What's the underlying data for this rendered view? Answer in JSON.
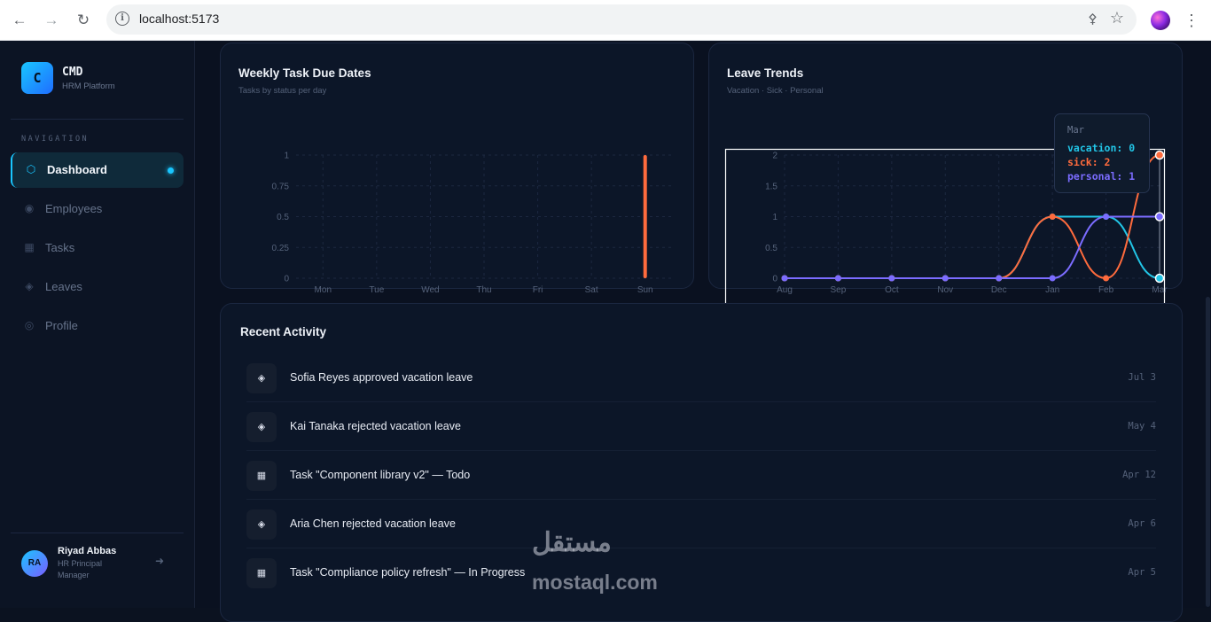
{
  "browser": {
    "url": "localhost:5173",
    "back_icon": "arrow-left",
    "forward_icon": "arrow-right",
    "reload_icon": "reload",
    "key_icon": "key",
    "star_icon": "star"
  },
  "brand": {
    "logo_letter": "C",
    "name": "CMD",
    "subtitle": "HRM Platform"
  },
  "sidebar": {
    "heading": "NAVIGATION",
    "items": [
      {
        "label": "Dashboard",
        "icon": "hexagon",
        "active": true
      },
      {
        "label": "Employees",
        "icon": "users"
      },
      {
        "label": "Tasks",
        "icon": "grid"
      },
      {
        "label": "Leaves",
        "icon": "diamond"
      },
      {
        "label": "Profile",
        "icon": "profile-circle"
      }
    ],
    "user": {
      "initials": "RA",
      "name": "Riyad Abbas",
      "role": "HR Principal Manager"
    }
  },
  "weekly_card": {
    "title": "Weekly Task Due Dates",
    "subtitle": "Tasks by status per day"
  },
  "leave_card": {
    "title": "Leave Trends",
    "subtitle": "Vacation · Sick · Personal"
  },
  "tooltip": {
    "title": "Mar",
    "rows": [
      "vacation: 0",
      "sick: 2",
      "personal: 1"
    ]
  },
  "activity": {
    "title": "Recent Activity",
    "items": [
      {
        "icon": "diamond",
        "text": "Sofia Reyes approved vacation leave",
        "date": "Jul 3"
      },
      {
        "icon": "diamond",
        "text": "Kai Tanaka rejected vacation leave",
        "date": "May 4"
      },
      {
        "icon": "grid",
        "text": "Task \"Component library v2\" — Todo",
        "date": "Apr 12"
      },
      {
        "icon": "diamond",
        "text": "Aria Chen rejected vacation leave",
        "date": "Apr 6"
      },
      {
        "icon": "grid",
        "text": "Task \"Compliance policy refresh\" — In Progress",
        "date": "Apr 5"
      }
    ]
  },
  "watermark": {
    "arabic": "مستقل",
    "latin": "mostaql.com"
  },
  "colors": {
    "accent": "#19c6ff",
    "vacation": "#22c5e6",
    "sick": "#ff6b3d",
    "personal": "#7b6cff"
  },
  "chart_data": [
    {
      "type": "bar",
      "title": "Weekly Task Due Dates",
      "subtitle": "Tasks by status per day",
      "categories": [
        "Mon",
        "Tue",
        "Wed",
        "Thu",
        "Fri",
        "Sat",
        "Sun"
      ],
      "series": [
        {
          "values": [
            0,
            0,
            0,
            0,
            0,
            0,
            1
          ],
          "color": "#ff6b3d"
        }
      ],
      "yticks": [
        "0",
        "0.25",
        "0.5",
        "0.75",
        "1"
      ],
      "ylim": [
        0,
        1
      ],
      "grid": true
    },
    {
      "type": "line",
      "title": "Leave Trends",
      "subtitle": "Vacation · Sick · Personal",
      "categories": [
        "Aug",
        "Sep",
        "Oct",
        "Nov",
        "Dec",
        "Jan",
        "Feb",
        "Mar"
      ],
      "series": [
        {
          "name": "vacation",
          "values": [
            0,
            0,
            0,
            0,
            0,
            1,
            1,
            0
          ],
          "color": "#22c5e6"
        },
        {
          "name": "sick",
          "values": [
            0,
            0,
            0,
            0,
            0,
            1,
            0,
            2
          ],
          "color": "#ff6b3d"
        },
        {
          "name": "personal",
          "values": [
            0,
            0,
            0,
            0,
            0,
            0,
            1,
            1
          ],
          "color": "#7b6cff"
        }
      ],
      "yticks": [
        "0",
        "0.5",
        "1",
        "1.5",
        "2"
      ],
      "ylim": [
        0,
        2
      ],
      "grid": true
    }
  ]
}
